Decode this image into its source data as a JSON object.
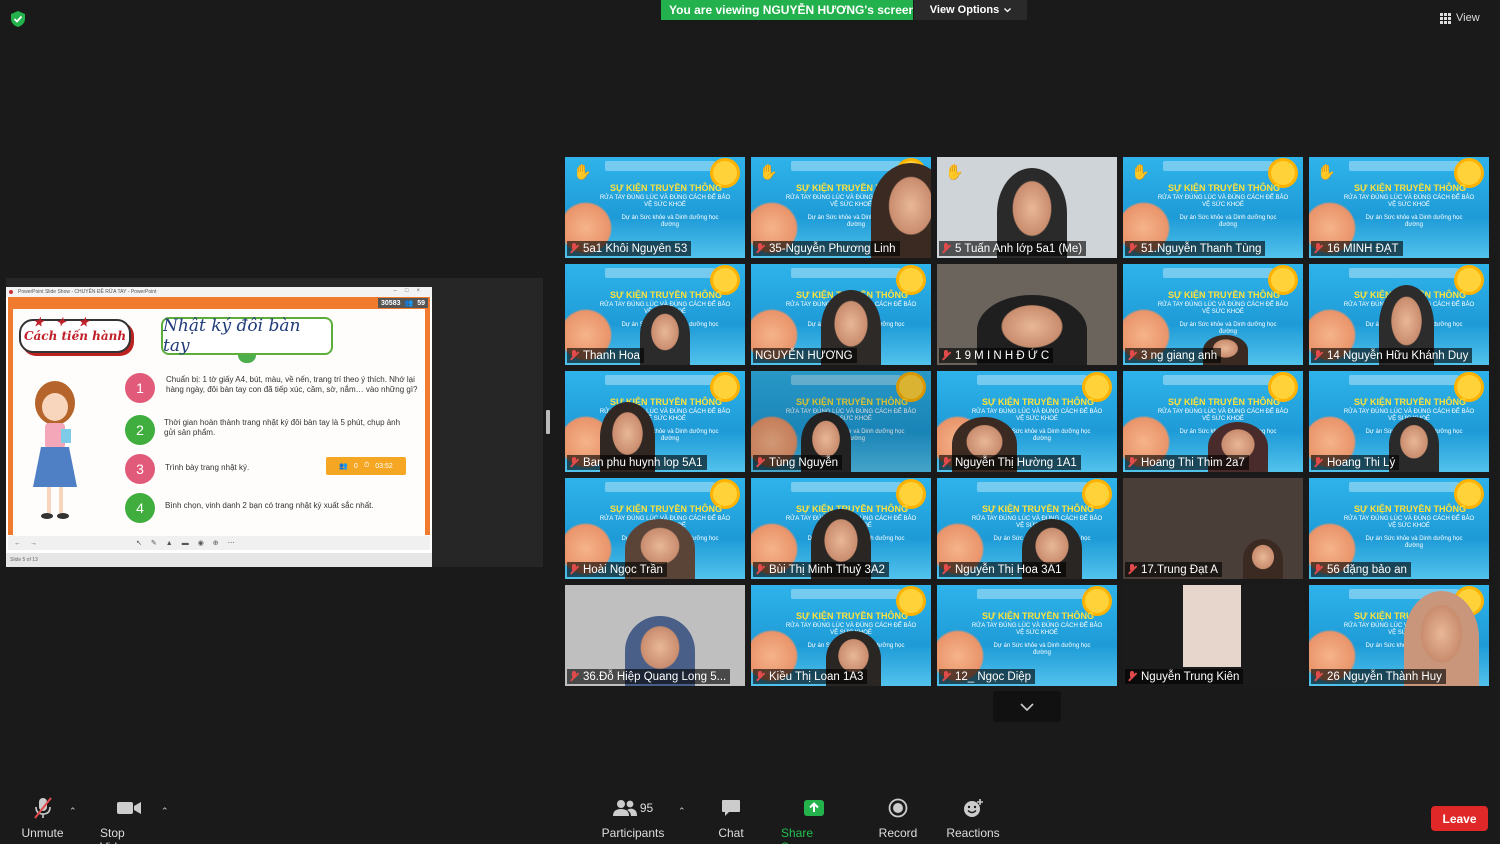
{
  "topbar": {
    "viewing_banner": "You are viewing NGUYỄN HƯƠNG's screen",
    "view_options": "View Options",
    "view_label": "View"
  },
  "shared_window": {
    "title": "PowerPoint Slide Show - CHUYÊN ĐỀ RỬA TAY - PowerPoint",
    "status": "Slide 5 of 13",
    "counter": {
      "votes": "30583",
      "viewers": "59"
    }
  },
  "slide": {
    "badge": "Cách tiến hành",
    "title": "Nhật ký đôi bàn tay",
    "steps": [
      {
        "num": "1",
        "text": "Chuẩn bị: 1 tờ giấy A4, bút, màu, về nến, trang trí theo ý thích. Nhớ lại hàng ngày, đôi bàn tay con đã tiếp xúc, cầm, sờ, nắm… vào những gì?"
      },
      {
        "num": "2",
        "text": "Thời gian hoàn thành trang nhật ký đôi bàn tay là 5 phút, chụp ảnh gửi sản phẩm."
      },
      {
        "num": "3",
        "text": "Trình bày trang nhật ký."
      },
      {
        "num": "4",
        "text": "Bình chọn, vinh danh 2 bạn có trang nhật ký xuất sắc nhất."
      }
    ],
    "timer": {
      "count": "0",
      "time": "03:52"
    }
  },
  "poster": {
    "line1": "SỰ KIỆN TRUYỀN THÔNG",
    "line2": "RỬA TAY ĐÚNG LÚC VÀ ĐÚNG CÁCH ĐỂ BẢO VỆ SỨC KHOẺ",
    "line3": "Dự án Sức khỏe và Dinh dưỡng học đường"
  },
  "participants": [
    {
      "name": "5a1 Khôi Nguyên 53"
    },
    {
      "name": "35-Nguyễn Phương Linh"
    },
    {
      "name": "5 Tuấn Anh lớp 5a1 (Me)"
    },
    {
      "name": "51.Nguyễn Thanh Tùng"
    },
    {
      "name": "16 MINH ĐẠT"
    },
    {
      "name": "Thanh Hoa"
    },
    {
      "name": "NGUYỄN HƯƠNG"
    },
    {
      "name": "1 9 M I N H Đ Ứ C"
    },
    {
      "name": "3 ng giang anh"
    },
    {
      "name": "14 Nguyễn Hữu Khánh Duy"
    },
    {
      "name": "Ban phu huynh lop 5A1"
    },
    {
      "name": "Tùng Nguyễn"
    },
    {
      "name": "Nguyễn Thị Hường 1A1"
    },
    {
      "name": "Hoang Thi Thim 2a7"
    },
    {
      "name": "Hoang Thi Lý"
    },
    {
      "name": "Hoài Ngọc Trần"
    },
    {
      "name": "Bùi Thị Minh Thuỷ 3A2"
    },
    {
      "name": "Nguyễn Thị Hoa 3A1"
    },
    {
      "name": "17.Trung Đạt A"
    },
    {
      "name": "56 đặng  bảo an"
    },
    {
      "name": "36.Đỗ Hiệp Quang Long 5..."
    },
    {
      "name": "Kiều Thị Loan 1A3"
    },
    {
      "name": "12_ Ngọc Diệp"
    },
    {
      "name": "Nguyễn Trung Kiên"
    },
    {
      "name": "26 Nguyễn Thành Huy"
    }
  ],
  "toolbar": {
    "unmute": "Unmute",
    "stop_video": "Stop Video",
    "participants": "Participants",
    "participants_count": "95",
    "chat": "Chat",
    "share_screen": "Share Screen",
    "record": "Record",
    "reactions": "Reactions",
    "leave": "Leave"
  },
  "colors": {
    "accent_green": "#22b14c",
    "leave_red": "#e02828",
    "muted_red": "#e24b4b",
    "background": "#1a1a1a"
  }
}
